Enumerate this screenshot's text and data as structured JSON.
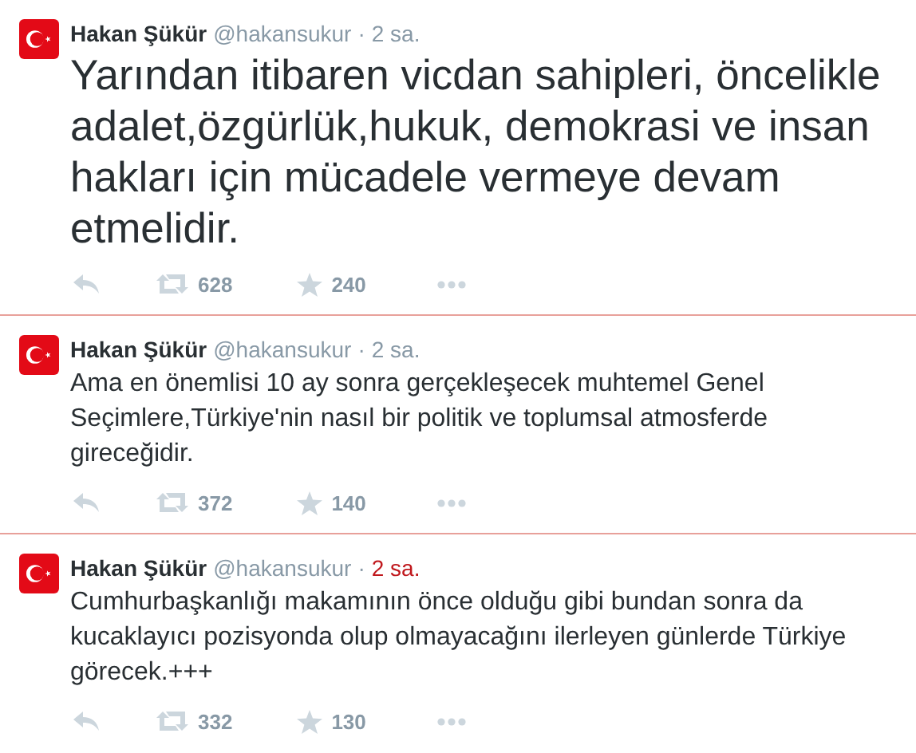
{
  "tweets": [
    {
      "name": "Hakan Şükür",
      "handle": "@hakansukur",
      "separator": "·",
      "time": "2 sa.",
      "time_hovered": false,
      "featured": true,
      "text": "Yarından itibaren vicdan sahipleri, öncelikle adalet,özgürlük,hukuk, demokrasi ve insan hakları için mücadele vermeye devam etmelidir.",
      "retweets": "628",
      "favorites": "240"
    },
    {
      "name": "Hakan Şükür",
      "handle": "@hakansukur",
      "separator": "·",
      "time": "2 sa.",
      "time_hovered": false,
      "featured": false,
      "text": "Ama en önemlisi 10 ay sonra gerçekleşecek muhtemel Genel Seçimlere,Türkiye'nin nasıl bir politik ve toplumsal atmosferde gireceğidir.",
      "retweets": "372",
      "favorites": "140"
    },
    {
      "name": "Hakan Şükür",
      "handle": "@hakansukur",
      "separator": "·",
      "time": "2 sa.",
      "time_hovered": true,
      "featured": false,
      "text": "Cumhurbaşkanlığı makamının önce olduğu gibi bundan sonra da kucaklayıcı pozisyonda olup olmayacağını ilerleyen günlerde Türkiye görecek.+++",
      "retweets": "332",
      "favorites": "130"
    }
  ]
}
